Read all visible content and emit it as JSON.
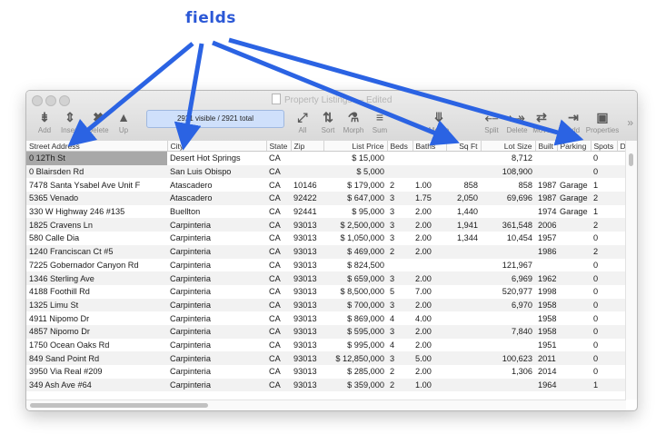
{
  "annotation": {
    "label": "fields"
  },
  "window": {
    "title": "Property Listings",
    "title_suffix": "— Edited",
    "status": "2921 visible / 2921 total",
    "toolbar": [
      {
        "label": "Add",
        "icon": "add-icon",
        "glyph": "⇟"
      },
      {
        "label": "Insert",
        "icon": "insert-icon",
        "glyph": "⇕"
      },
      {
        "label": "Delete",
        "icon": "delete-icon",
        "glyph": "✖"
      },
      {
        "label": "Up",
        "icon": "up-icon",
        "glyph": "▲"
      },
      {
        "label": "All",
        "icon": "all-icon",
        "glyph": "⤢"
      },
      {
        "label": "Sort",
        "icon": "sort-icon",
        "glyph": "⇅"
      },
      {
        "label": "Morph",
        "icon": "morph-icon",
        "glyph": "⚗"
      },
      {
        "label": "Sum",
        "icon": "sum-icon",
        "glyph": "≡"
      },
      {
        "label": "Merge",
        "icon": "merge-icon",
        "glyph": "⤋"
      },
      {
        "label": "Split",
        "icon": "split-icon",
        "glyph": "⤌"
      },
      {
        "label": "Delete",
        "icon": "delete-column-icon",
        "glyph": "⤐"
      },
      {
        "label": "Move",
        "icon": "move-icon",
        "glyph": "⇄"
      },
      {
        "label": "Add",
        "icon": "add-column-icon",
        "glyph": "⇥"
      },
      {
        "label": "Properties",
        "icon": "properties-icon",
        "glyph": "▣"
      }
    ],
    "more_glyph": "»"
  },
  "table": {
    "columns": [
      "Street Address",
      "City",
      "State",
      "Zip",
      "List Price",
      "Beds",
      "Baths",
      "Sq Ft",
      "Lot Size",
      "Built",
      "Parking",
      "Spots",
      "D"
    ],
    "rows": [
      [
        "0 12Th St",
        "Desert Hot Springs",
        "CA",
        "",
        "$ 15,000",
        "",
        "",
        "",
        "8,712",
        "",
        "",
        "0",
        ""
      ],
      [
        "0 Blairsden Rd",
        "San Luis Obispo",
        "CA",
        "",
        "$ 5,000",
        "",
        "",
        "",
        "108,900",
        "",
        "",
        "0",
        ""
      ],
      [
        "7478 Santa Ysabel Ave Unit F",
        "Atascadero",
        "CA",
        "10146",
        "$ 179,000",
        "2",
        "1.00",
        "858",
        "858",
        "1987",
        "Garage",
        "1",
        ""
      ],
      [
        "5365 Venado",
        "Atascadero",
        "CA",
        "92422",
        "$ 647,000",
        "3",
        "1.75",
        "2,050",
        "69,696",
        "1987",
        "Garage",
        "2",
        ""
      ],
      [
        "330 W Highway 246 #135",
        "Buellton",
        "CA",
        "92441",
        "$ 95,000",
        "3",
        "2.00",
        "1,440",
        "",
        "1974",
        "Garage",
        "1",
        ""
      ],
      [
        "1825 Cravens Ln",
        "Carpinteria",
        "CA",
        "93013",
        "$ 2,500,000",
        "3",
        "2.00",
        "1,941",
        "361,548",
        "2006",
        "",
        "2",
        ""
      ],
      [
        "580 Calle Dia",
        "Carpinteria",
        "CA",
        "93013",
        "$ 1,050,000",
        "3",
        "2.00",
        "1,344",
        "10,454",
        "1957",
        "",
        "0",
        ""
      ],
      [
        "1240 Franciscan Ct #5",
        "Carpinteria",
        "CA",
        "93013",
        "$ 469,000",
        "2",
        "2.00",
        "",
        "",
        "1986",
        "",
        "2",
        ""
      ],
      [
        "7225 Gobernador Canyon Rd",
        "Carpinteria",
        "CA",
        "93013",
        "$ 824,500",
        "",
        "",
        "",
        "121,967",
        "",
        "",
        "0",
        ""
      ],
      [
        "1346 Sterling Ave",
        "Carpinteria",
        "CA",
        "93013",
        "$ 659,000",
        "3",
        "2.00",
        "",
        "6,969",
        "1962",
        "",
        "0",
        ""
      ],
      [
        "4188 Foothill Rd",
        "Carpinteria",
        "CA",
        "93013",
        "$ 8,500,000",
        "5",
        "7.00",
        "",
        "520,977",
        "1998",
        "",
        "0",
        ""
      ],
      [
        "1325 Limu St",
        "Carpinteria",
        "CA",
        "93013",
        "$ 700,000",
        "3",
        "2.00",
        "",
        "6,970",
        "1958",
        "",
        "0",
        ""
      ],
      [
        "4911 Nipomo Dr",
        "Carpinteria",
        "CA",
        "93013",
        "$ 869,000",
        "4",
        "4.00",
        "",
        "",
        "1958",
        "",
        "0",
        ""
      ],
      [
        "4857 Nipomo Dr",
        "Carpinteria",
        "CA",
        "93013",
        "$ 595,000",
        "3",
        "2.00",
        "",
        "7,840",
        "1958",
        "",
        "0",
        ""
      ],
      [
        "1750 Ocean Oaks Rd",
        "Carpinteria",
        "CA",
        "93013",
        "$ 995,000",
        "4",
        "2.00",
        "",
        "",
        "1951",
        "",
        "0",
        ""
      ],
      [
        "849 Sand Point Rd",
        "Carpinteria",
        "CA",
        "93013",
        "$ 12,850,000",
        "3",
        "5.00",
        "",
        "100,623",
        "2011",
        "",
        "0",
        ""
      ],
      [
        "3950 Via Real #209",
        "Carpinteria",
        "CA",
        "93013",
        "$ 285,000",
        "2",
        "2.00",
        "",
        "1,306",
        "2014",
        "",
        "0",
        ""
      ],
      [
        "349 Ash Ave #64",
        "Carpinteria",
        "CA",
        "93013",
        "$ 359,000",
        "2",
        "1.00",
        "",
        "",
        "1964",
        "",
        "1",
        ""
      ]
    ]
  },
  "colors": {
    "arrow": "#2b63e3",
    "status_bg": "#cfe0fb",
    "selected": "#a8a8a8"
  }
}
